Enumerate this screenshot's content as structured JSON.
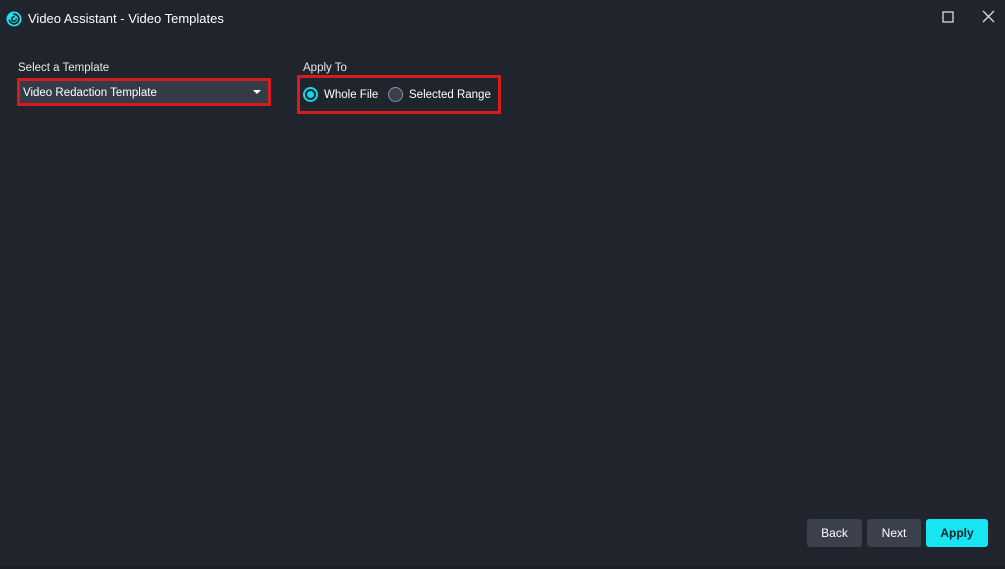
{
  "window": {
    "title": "Video Assistant - Video Templates",
    "accent_color": "#16e6f2",
    "highlight_color": "#d81a21"
  },
  "template": {
    "label": "Select a Template",
    "selected": "Video Redaction Template"
  },
  "apply_to": {
    "label": "Apply To",
    "options": [
      {
        "label": "Whole File",
        "checked": true
      },
      {
        "label": "Selected Range",
        "checked": false
      }
    ]
  },
  "footer": {
    "back_label": "Back",
    "next_label": "Next",
    "apply_label": "Apply"
  },
  "icons": {
    "app": "video-assistant-logo-icon",
    "maximize": "maximize-icon",
    "close": "close-icon",
    "dropdown": "chevron-down-icon"
  }
}
